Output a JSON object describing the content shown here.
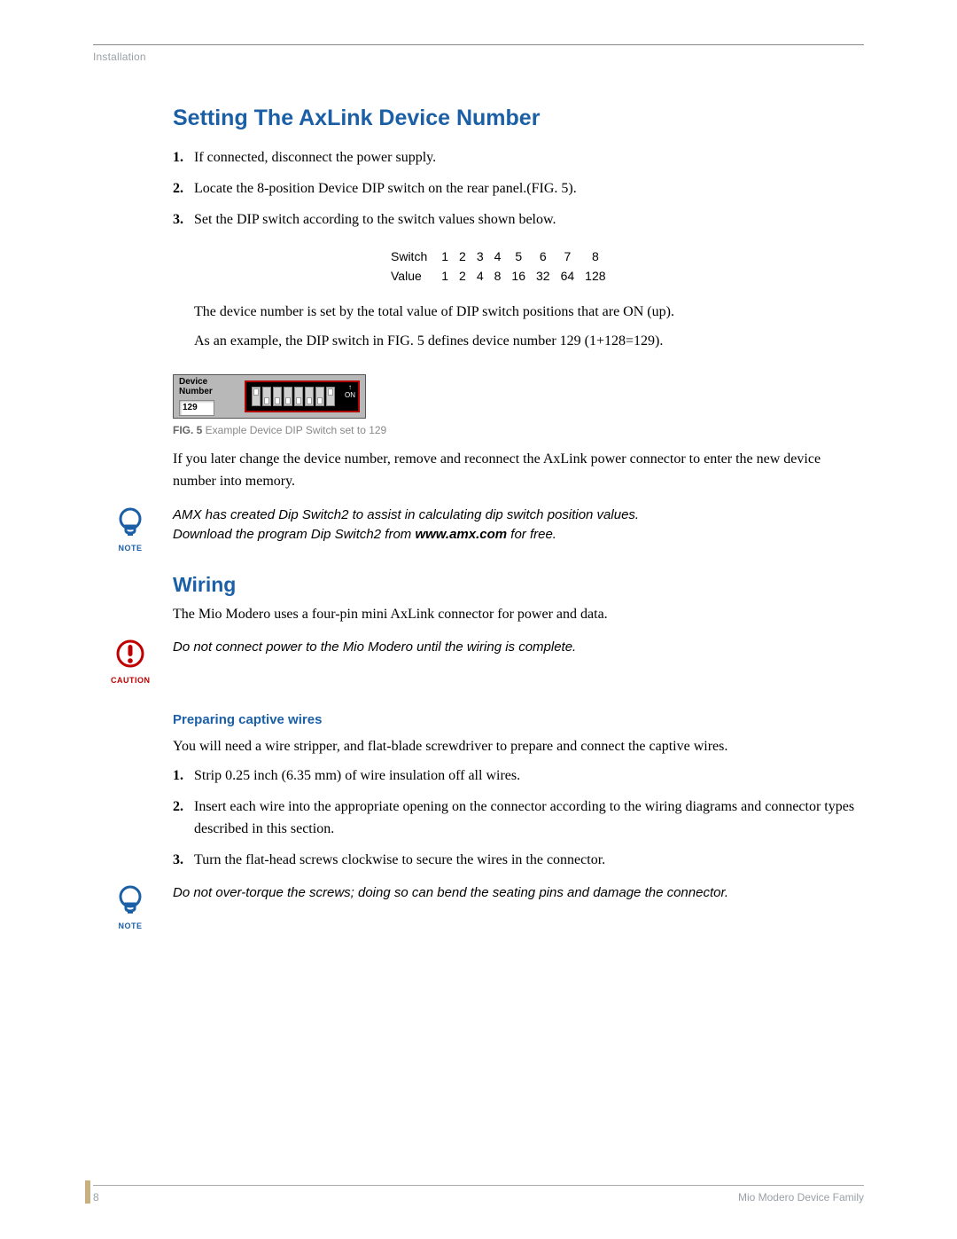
{
  "header": {
    "section": "Installation"
  },
  "s1": {
    "heading": "Setting The AxLink Device Number",
    "steps": [
      "If connected, disconnect the power supply.",
      "Locate the 8-position Device DIP switch on the rear panel.(FIG. 5).",
      "Set the DIP switch according to the switch values shown below."
    ],
    "switch_table": {
      "row1_label": "Switch",
      "row1": [
        "1",
        "2",
        "3",
        "4",
        "5",
        "6",
        "7",
        "8"
      ],
      "row2_label": "Value",
      "row2": [
        "1",
        "2",
        "4",
        "8",
        "16",
        "32",
        "64",
        "128"
      ]
    },
    "para1": "The device number is set by the total value of DIP switch positions that are ON (up).",
    "para2": "As an example, the DIP switch in FIG. 5 defines device number 129 (1+128=129).",
    "dip": {
      "label": "Device Number",
      "value": "129",
      "on_text": "ON",
      "arrow": "↑"
    },
    "fig5_strong": "FIG. 5",
    "fig5_text": "  Example Device DIP Switch set to 129",
    "para3": "If you later change the device number, remove and reconnect the AxLink power connector to enter the new device number into memory.",
    "note1_a": "AMX has created Dip Switch2 to assist in calculating dip switch position values.",
    "note1_b_pre": "Download the program Dip Switch2 from ",
    "note1_b_bold": "www.amx.com",
    "note1_b_post": " for free."
  },
  "s2": {
    "heading": "Wiring",
    "para1": "The Mio Modero uses a four-pin mini AxLink connector for power and data.",
    "caution": "Do not connect power to the Mio Modero until the wiring is complete.",
    "h3": "Preparing captive wires",
    "para2": "You will need a wire stripper, and flat-blade screwdriver to prepare and connect the captive wires.",
    "steps": [
      "Strip 0.25 inch (6.35 mm) of wire insulation off all wires.",
      "Insert each wire into the appropriate opening on the connector according to the wiring diagrams and connector types described in this section.",
      "Turn the flat-head screws clockwise to secure the wires in the connector."
    ],
    "note2": "Do not over-torque the screws; doing so can bend the seating pins and damage the connector."
  },
  "labels": {
    "note": "NOTE",
    "caution": "CAUTION"
  },
  "footer": {
    "page": "8",
    "title": "Mio Modero Device Family"
  }
}
